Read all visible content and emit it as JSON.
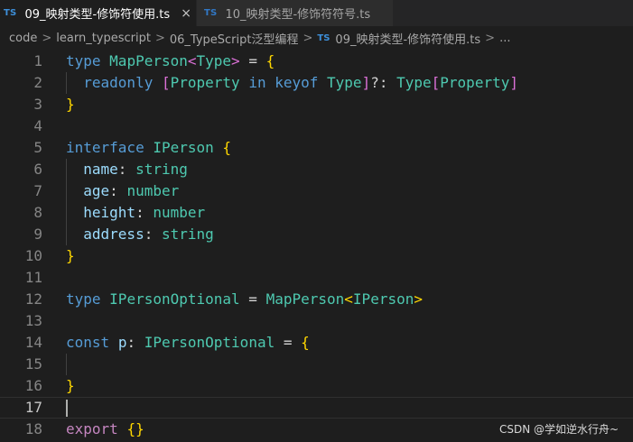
{
  "tabs": [
    {
      "icon": "TS",
      "label": "09_映射类型-修饰符使用.ts",
      "close": "×",
      "active": true
    },
    {
      "icon": "TS",
      "label": "10_映射类型-修饰符符号.ts",
      "active": false
    }
  ],
  "breadcrumb": {
    "items": [
      "code",
      "learn_typescript",
      "06_TypeScript泛型编程"
    ],
    "file_icon": "TS",
    "file": "09_映射类型-修饰符使用.ts",
    "ellipsis": "...",
    "separator": ">"
  },
  "editor": {
    "current_line": 17,
    "lines": [
      {
        "n": "1",
        "tokens": [
          [
            "kw",
            "type"
          ],
          [
            "op",
            " "
          ],
          [
            "tp",
            "MapPerson"
          ],
          [
            "br2",
            "<"
          ],
          [
            "tp",
            "Type"
          ],
          [
            "br2",
            ">"
          ],
          [
            "op",
            " = "
          ],
          [
            "br1",
            "{"
          ]
        ]
      },
      {
        "n": "2",
        "tokens": [
          [
            "op",
            "  "
          ],
          [
            "kw",
            "readonly"
          ],
          [
            "op",
            " "
          ],
          [
            "br2",
            "["
          ],
          [
            "tp",
            "Property"
          ],
          [
            "op",
            " "
          ],
          [
            "kw",
            "in"
          ],
          [
            "op",
            " "
          ],
          [
            "kw",
            "keyof"
          ],
          [
            "op",
            " "
          ],
          [
            "tp",
            "Type"
          ],
          [
            "br2",
            "]"
          ],
          [
            "op",
            "?: "
          ],
          [
            "tp",
            "Type"
          ],
          [
            "br2",
            "["
          ],
          [
            "tp",
            "Property"
          ],
          [
            "br2",
            "]"
          ]
        ]
      },
      {
        "n": "3",
        "tokens": [
          [
            "br1",
            "}"
          ]
        ]
      },
      {
        "n": "4",
        "tokens": []
      },
      {
        "n": "5",
        "tokens": [
          [
            "kw",
            "interface"
          ],
          [
            "op",
            " "
          ],
          [
            "tp",
            "IPerson"
          ],
          [
            "op",
            " "
          ],
          [
            "br1",
            "{"
          ]
        ]
      },
      {
        "n": "6",
        "tokens": [
          [
            "op",
            "  "
          ],
          [
            "pr",
            "name"
          ],
          [
            "op",
            ": "
          ],
          [
            "tp",
            "string"
          ]
        ]
      },
      {
        "n": "7",
        "tokens": [
          [
            "op",
            "  "
          ],
          [
            "pr",
            "age"
          ],
          [
            "op",
            ": "
          ],
          [
            "tp",
            "number"
          ]
        ]
      },
      {
        "n": "8",
        "tokens": [
          [
            "op",
            "  "
          ],
          [
            "pr",
            "height"
          ],
          [
            "op",
            ": "
          ],
          [
            "tp",
            "number"
          ]
        ]
      },
      {
        "n": "9",
        "tokens": [
          [
            "op",
            "  "
          ],
          [
            "pr",
            "address"
          ],
          [
            "op",
            ": "
          ],
          [
            "tp",
            "string"
          ]
        ]
      },
      {
        "n": "10",
        "tokens": [
          [
            "br1",
            "}"
          ]
        ]
      },
      {
        "n": "11",
        "tokens": []
      },
      {
        "n": "12",
        "tokens": [
          [
            "kw",
            "type"
          ],
          [
            "op",
            " "
          ],
          [
            "tp",
            "IPersonOptional"
          ],
          [
            "op",
            " = "
          ],
          [
            "tp",
            "MapPerson"
          ],
          [
            "br1",
            "<"
          ],
          [
            "tp",
            "IPerson"
          ],
          [
            "br1",
            ">"
          ]
        ]
      },
      {
        "n": "13",
        "tokens": []
      },
      {
        "n": "14",
        "tokens": [
          [
            "kw",
            "const"
          ],
          [
            "op",
            " "
          ],
          [
            "pr",
            "p"
          ],
          [
            "op",
            ": "
          ],
          [
            "tp",
            "IPersonOptional"
          ],
          [
            "op",
            " = "
          ],
          [
            "br1",
            "{"
          ]
        ]
      },
      {
        "n": "15",
        "tokens": []
      },
      {
        "n": "16",
        "tokens": [
          [
            "br1",
            "}"
          ]
        ]
      },
      {
        "n": "17",
        "tokens": []
      },
      {
        "n": "18",
        "tokens": [
          [
            "kw2",
            "export"
          ],
          [
            "op",
            " "
          ],
          [
            "br1",
            "{}"
          ]
        ]
      }
    ]
  },
  "watermark": "CSDN @学如逆水行舟~"
}
